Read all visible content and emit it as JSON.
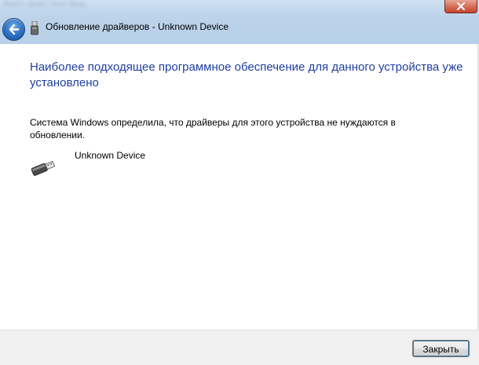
{
  "window": {
    "title": "Обновление драйверов - Unknown Device",
    "background_blur_text": "Файл Действие Вид"
  },
  "content": {
    "heading": "Наиболее подходящее программное обеспечение для данного устройства уже установлено",
    "description": "Система Windows определила, что драйверы для этого устройства не нуждаются в обновлении.",
    "device_name": "Unknown Device"
  },
  "footer": {
    "close_label": "Закрыть"
  },
  "colors": {
    "heading": "#1f3f9e",
    "titlebar": "#bcd3ea",
    "close_red": "#c7442b"
  },
  "icons": {
    "back": "back-arrow-icon",
    "title": "usb-device-icon",
    "device": "usb-plug-icon"
  }
}
